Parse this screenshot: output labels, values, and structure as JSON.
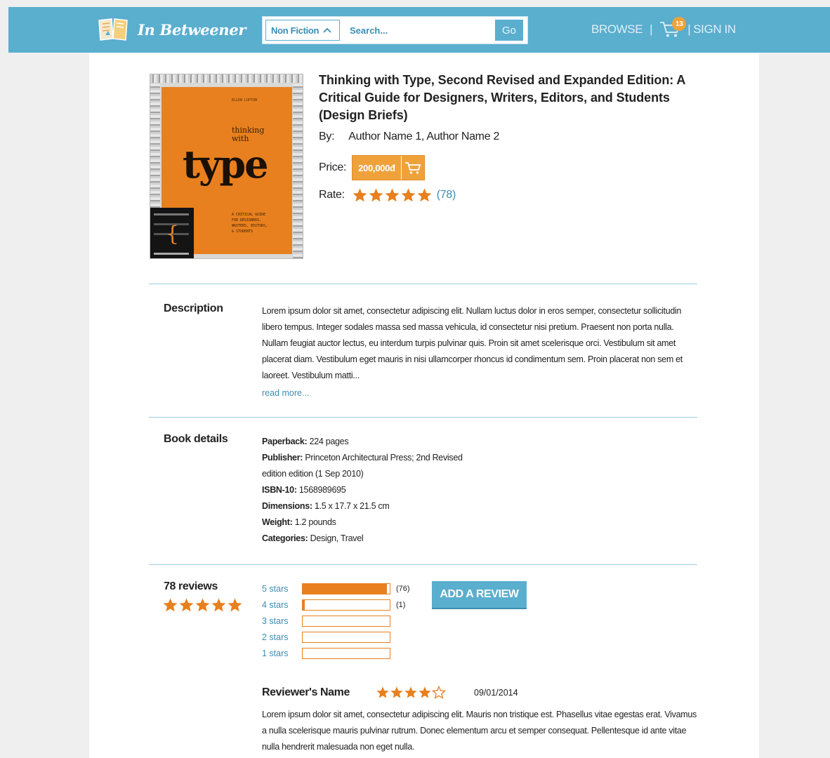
{
  "header": {
    "brand": "In Betweener",
    "search": {
      "category": "Non Fiction",
      "placeholder": "Search...",
      "go_label": "Go"
    },
    "nav": {
      "browse": "BROWSE",
      "separator": "|",
      "cart_count": "13",
      "sign_in": "SIGN IN"
    }
  },
  "book": {
    "title": "Thinking with Type, Second Revised and Expanded Edition: A Critical Guide for Designers, Writers, Editors, and Students (Design Briefs)",
    "by_label": "By:",
    "authors": "Author Name 1, Author Name 2",
    "price_label": "Price:",
    "price": "200,000đ",
    "rate_label": "Rate:",
    "rating": 5,
    "rating_count": "(78)",
    "cover": {
      "small_title": "ELLEN LUPTON",
      "word1": "thinking",
      "word2": "with",
      "word3": "type",
      "blurb": "A CRITICAL GUIDE\nFOR DESIGNERS,\nWRITERS, EDITORS,\n& STUDENTS"
    }
  },
  "description": {
    "label": "Description",
    "text": "Lorem ipsum dolor sit amet, consectetur adipiscing elit. Nullam luctus dolor in eros semper, consectetur sollicitudin libero tempus. Integer sodales massa sed massa vehicula, id consectetur nisi pretium. Praesent non porta nulla. Nullam feugiat auctor lectus, eu interdum turpis pulvinar quis. Proin sit amet scelerisque orci. Vestibulum sit amet placerat diam. Vestibulum eget mauris in nisi ullamcorper rhoncus id condimentum sem. Proin placerat non sem et laoreet. Vestibulum matti...",
    "read_more": "read more..."
  },
  "details": {
    "label": "Book details",
    "items": [
      {
        "key": "Paperback:",
        "value": "224 pages"
      },
      {
        "key": "Publisher:",
        "value": "Princeton Architectural Press; 2nd Revised edition edition (1 Sep 2010)"
      },
      {
        "key": "ISBN-10:",
        "value": "1568989695"
      },
      {
        "key": "Dimensions:",
        "value": "1.5 x 17.7 x 21.5 cm"
      },
      {
        "key": "Weight:",
        "value": "1.2 pounds"
      },
      {
        "key": "Categories:",
        "value": "Design, Travel"
      }
    ]
  },
  "reviews": {
    "count_label": "78 reviews",
    "overall_rating": 5,
    "add_review_label": "ADD A REVIEW",
    "breakdown": [
      {
        "label": "5 stars",
        "fraction": 0.97,
        "count": "(76)"
      },
      {
        "label": "4 stars",
        "fraction": 0.03,
        "count": "(1)"
      },
      {
        "label": "3 stars",
        "fraction": 0,
        "count": ""
      },
      {
        "label": "2 stars",
        "fraction": 0,
        "count": ""
      },
      {
        "label": "1 stars",
        "fraction": 0,
        "count": ""
      }
    ],
    "items": [
      {
        "name": "Reviewer's Name",
        "rating": 4,
        "date": "09/01/2014",
        "text": "Lorem ipsum dolor sit amet, consectetur adipiscing elit. Mauris non tristique est. Phasellus vitae egestas erat. Vivamus a nulla scelerisque mauris pulvinar rutrum. Donec elementum arcu et semper consequat. Pellentesque id ante vitae nulla hendrerit malesuada non eget nulla."
      }
    ]
  },
  "colors": {
    "header_bg": "#5aaece",
    "accent_orange": "#e8801f",
    "price_orange": "#f0a23a",
    "link_blue": "#3b8db5"
  }
}
